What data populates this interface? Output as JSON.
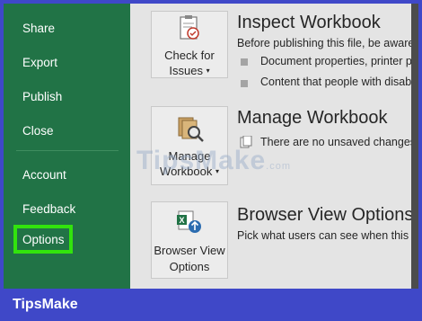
{
  "sidebar": {
    "items": [
      {
        "label": "Share"
      },
      {
        "label": "Export"
      },
      {
        "label": "Publish"
      },
      {
        "label": "Close"
      },
      {
        "label": "Account"
      },
      {
        "label": "Feedback"
      },
      {
        "label": "Options"
      }
    ],
    "highlight_color": "#32e30d"
  },
  "sections": {
    "inspect": {
      "tile_line1": "Check for",
      "tile_line2": "Issues",
      "title": "Inspect Workbook",
      "desc": "Before publishing this file, be aware",
      "bullets": [
        "Document properties, printer p",
        "Content that people with disab"
      ]
    },
    "manage": {
      "tile_line1": "Manage",
      "tile_line2": "Workbook",
      "title": "Manage Workbook",
      "note": "There are no unsaved changes."
    },
    "browser": {
      "tile_line1": "Browser View",
      "tile_line2": "Options",
      "title": "Browser View Options",
      "desc": "Pick what users can see when this"
    }
  },
  "icons": {
    "checklist": "checklist-icon",
    "manage": "document-magnifier-icon",
    "browser": "excel-globe-icon"
  },
  "watermark": {
    "text": "TipsMake",
    "suffix": ".com"
  },
  "brand": "TipsMake",
  "colors": {
    "sidebar": "#217346",
    "frame_bg": "#3f48c8",
    "panel": "#e4e4e4"
  }
}
